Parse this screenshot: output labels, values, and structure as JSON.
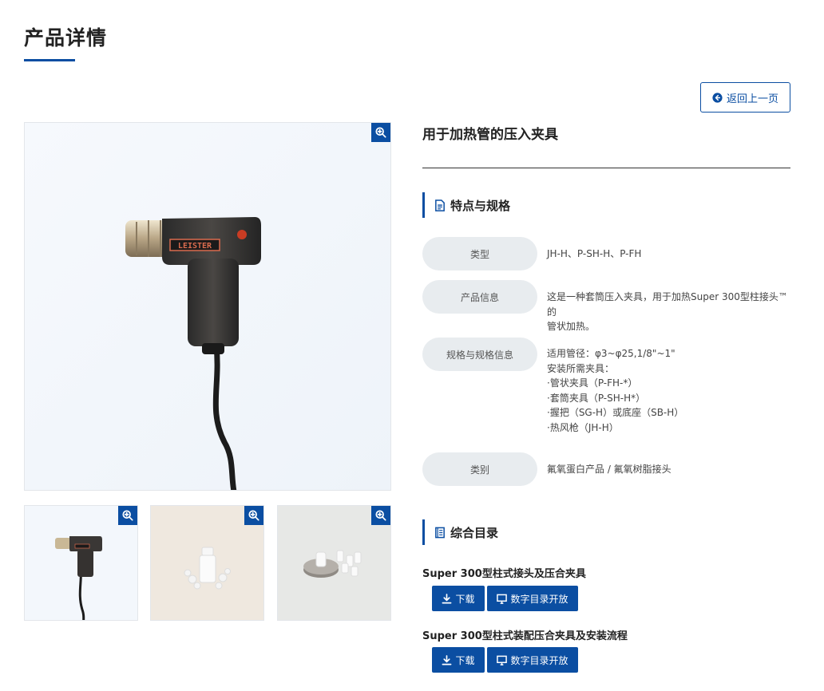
{
  "page": {
    "title": "产品详情"
  },
  "back_button": {
    "label": "返回上一页"
  },
  "product": {
    "name": "用于加热管的压入夹具"
  },
  "features": {
    "heading": "特点与规格",
    "rows": [
      {
        "label": "类型",
        "value": "JH-H、P-SH-H、P-FH"
      },
      {
        "label": "产品信息",
        "lines": [
          "这是一种套筒压入夹具，用于加热Super 300型柱接头™的",
          "管状加热。"
        ]
      },
      {
        "label": "规格与规格信息",
        "lines": [
          "适用管径：φ3~φ25,1/8\"~1\"",
          "安装所需夹具：",
          "·管状夹具（P-FH-*）",
          "·套筒夹具（P-SH-H*）",
          "·握把（SG-H）或底座（SB-H）",
          "·热风枪（JH-H）"
        ]
      },
      {
        "label": "类别",
        "value": "氟氧蛋白产品 / 氟氧树脂接头"
      }
    ]
  },
  "catalog": {
    "heading": "综合目录",
    "items": [
      {
        "title": "Super 300型柱式接头及压合夹具",
        "download": "下载",
        "open": "数字目录开放"
      },
      {
        "title": "Super 300型柱式装配压合夹具及安装流程",
        "download": "下载",
        "open": "数字目录开放"
      }
    ]
  },
  "image": {
    "brand_label": "LEISTER"
  },
  "colors": {
    "accent": "#0b4ea2",
    "label_bg": "#e8ecef"
  },
  "icons": {
    "zoom": "zoom-in-icon",
    "back": "arrow-circle-left-icon",
    "doc": "document-icon",
    "catalog": "book-icon",
    "download": "download-icon",
    "monitor": "monitor-icon"
  }
}
